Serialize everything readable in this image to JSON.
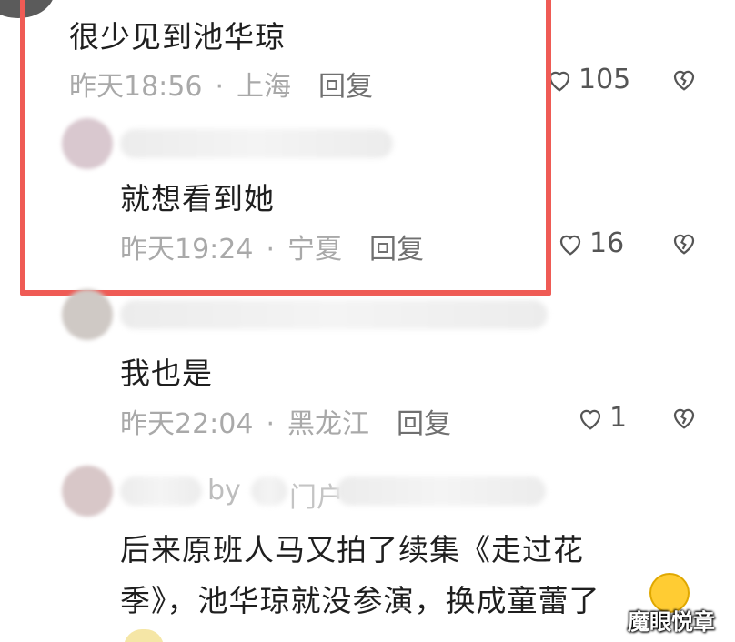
{
  "comments": [
    {
      "body": "很少见到池华琼",
      "time": "昨天18:56",
      "location": "上海",
      "reply": "回复",
      "likes": "105"
    },
    {
      "body": "就想看到她",
      "time": "昨天19:24",
      "location": "宁夏",
      "reply": "回复",
      "likes": "16"
    },
    {
      "body": "我也是",
      "time": "昨天22:04",
      "location": "黑龙江",
      "reply": "回复",
      "likes": "1"
    },
    {
      "name_partial_1": "by",
      "name_partial_2": "门户",
      "body_line1": "后来原班人马又拍了续集《走过花",
      "body_line2": "季》，池华琼就没参演，换成童蕾了"
    }
  ],
  "separator": "·",
  "watermark": "魔眼悦章",
  "icons": [
    "heart-icon",
    "broken-heart-icon",
    "laugh-cry-emoji"
  ],
  "colors": {
    "highlight": "#ef5b55",
    "meta": "#a9a9a9",
    "text": "#1f1f1f"
  }
}
